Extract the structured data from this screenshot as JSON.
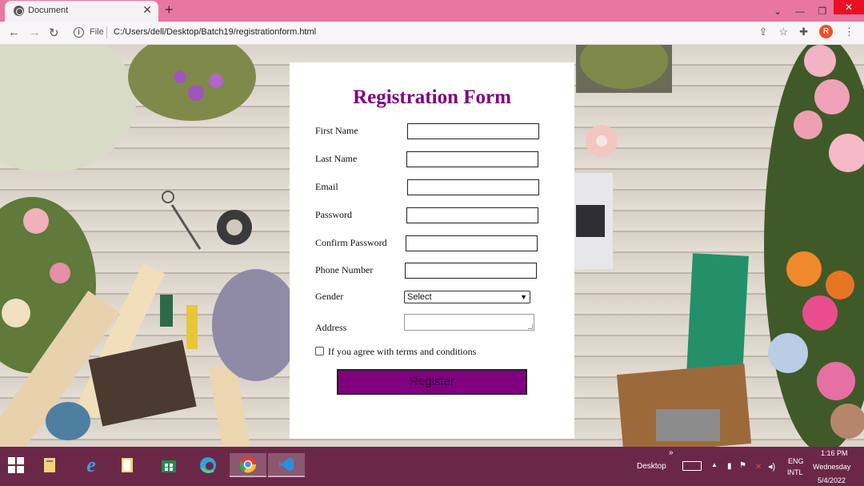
{
  "browser": {
    "tab_title": "Document",
    "tab_close": "✕",
    "new_tab": "+",
    "scheme": "File",
    "url": "C:/Users/dell/Desktop/Batch19/registrationform.html",
    "profile_initial": "R",
    "window_controls": [
      "⌄",
      "—",
      "❐",
      "✕"
    ]
  },
  "form": {
    "title": "Registration Form",
    "fields": {
      "first_name": "First Name",
      "last_name": "Last Name",
      "email": "Email",
      "password": "Password",
      "confirm_password": "Confirm Password",
      "phone": "Phone Number",
      "gender": "Gender",
      "address": "Address"
    },
    "gender_selected": "Select",
    "terms": "If you agree with terms and conditions",
    "register": "Register"
  },
  "taskbar": {
    "desktop_label": "Desktop",
    "overflow": "»",
    "lang_top": "ENG",
    "lang_bottom": "INTL",
    "time": "1:16 PM",
    "day": "Wednesday",
    "date": "5/4/2022"
  },
  "colors": {
    "accent": "#800080",
    "tab_bar": "#e8779f",
    "taskbar": "#6b2748"
  }
}
